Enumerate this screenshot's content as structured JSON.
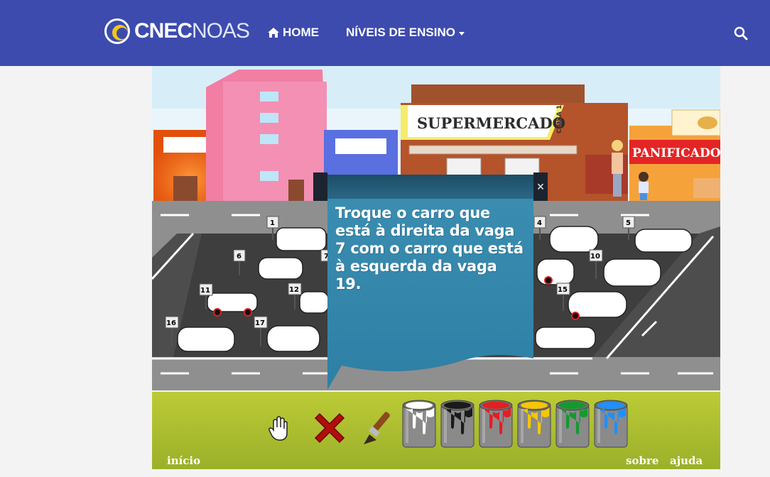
{
  "brand": {
    "bold": "CNEC",
    "light": "NOAS"
  },
  "nav": {
    "home_label": "HOME",
    "levels_label": "NÍVEIS DE ENSINO"
  },
  "scene": {
    "store_sign": "SUPERMERCADO",
    "store_sub": "CAIXA 1",
    "bakery_sign": "PANIFICADORA",
    "spots": [
      "1",
      "4",
      "5",
      "6",
      "7",
      "10",
      "11",
      "12",
      "15",
      "16",
      "17"
    ]
  },
  "modal": {
    "text": "Troque o carro que está à direita da vaga 7 com o carro que está à esquerda da vaga 19.",
    "close_label": "×"
  },
  "toolbar": {
    "paints": [
      {
        "name": "white",
        "color": "#ffffff"
      },
      {
        "name": "black",
        "color": "#1a1a1a"
      },
      {
        "name": "red",
        "color": "#e31e24"
      },
      {
        "name": "yellow",
        "color": "#f7c600"
      },
      {
        "name": "green",
        "color": "#139a2e"
      },
      {
        "name": "blue",
        "color": "#1e90ff"
      }
    ],
    "start_label": "início",
    "about_label": "sobre",
    "help_label": "ajuda"
  }
}
